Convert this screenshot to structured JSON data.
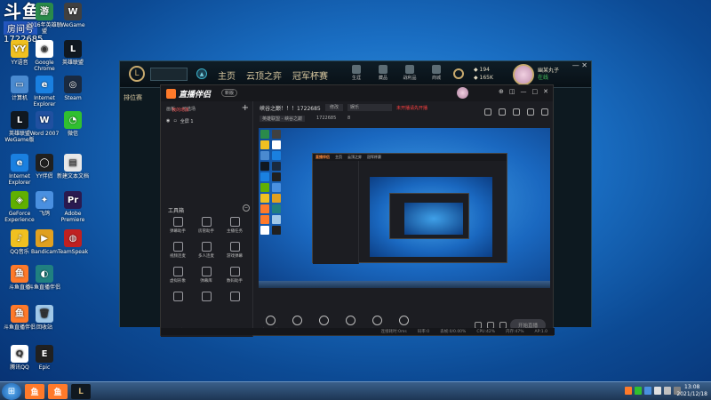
{
  "overlay": {
    "big": "斗鱼",
    "label": "房间号",
    "number": "1722685"
  },
  "desktop_icons": [
    {
      "label": "2016年英雄联盟",
      "color": "#2a8a4a",
      "glyph": "游"
    },
    {
      "label": "WeGame",
      "color": "#404040",
      "glyph": "W"
    },
    {
      "label": "YY语音",
      "color": "#f0c020",
      "glyph": "YY"
    },
    {
      "label": "Google Chrome",
      "color": "#ffffff",
      "glyph": "◉"
    },
    {
      "label": "英雄联盟",
      "color": "#101820",
      "glyph": "L"
    },
    {
      "label": "计算机",
      "color": "#4a8ad0",
      "glyph": "▭"
    },
    {
      "label": "Internet Explorer",
      "color": "#1a80e0",
      "glyph": "e"
    },
    {
      "label": "Steam",
      "color": "#1a2a40",
      "glyph": "◎"
    },
    {
      "label": "英雄联盟 WeGame版",
      "color": "#101820",
      "glyph": "L"
    },
    {
      "label": "Word 2007",
      "color": "#2050a0",
      "glyph": "W"
    },
    {
      "label": "微信",
      "color": "#30c030",
      "glyph": "◔"
    },
    {
      "label": "Internet Explorer",
      "color": "#1a80e0",
      "glyph": "e"
    },
    {
      "label": "YY伴侣",
      "color": "#202020",
      "glyph": "◯"
    },
    {
      "label": "新建文本文档",
      "color": "#e8e8e8",
      "glyph": "▤"
    },
    {
      "label": "GeForce Experience",
      "color": "#60b000",
      "glyph": "◈"
    },
    {
      "label": "飞鸽",
      "color": "#4a90e0",
      "glyph": "✦"
    },
    {
      "label": "Adobe Premiere",
      "color": "#2a1a50",
      "glyph": "Pr"
    },
    {
      "label": "QQ音乐",
      "color": "#f0c020",
      "glyph": "♪"
    },
    {
      "label": "Bandicam",
      "color": "#e0a020",
      "glyph": "▶"
    },
    {
      "label": "TeamSpeak",
      "color": "#c02020",
      "glyph": "◍"
    },
    {
      "label": "斗鱼直播",
      "color": "#ff7a2a",
      "glyph": "鱼"
    },
    {
      "label": "斗鱼直播伴侣",
      "color": "#208080",
      "glyph": "◐"
    },
    {
      "label": "斗鱼直播伴侣",
      "color": "#ff7a2a",
      "glyph": "鱼"
    },
    {
      "label": "回收站",
      "color": "#a0c8e8",
      "glyph": "🗑"
    },
    {
      "label": "腾讯QQ",
      "color": "#ffffff",
      "glyph": "Q"
    },
    {
      "label": "Epic",
      "color": "#202020",
      "glyph": "E"
    }
  ],
  "lol": {
    "nav": [
      "主页",
      "云顶之弈",
      "冠军杯赛"
    ],
    "right_icons": [
      "生涯",
      "藏品",
      "战利品",
      "商城"
    ],
    "currency_be": "194",
    "currency_rp": "165K",
    "summoner": "幽某丸子",
    "status": "在线",
    "left_title": "排位赛",
    "win_controls": "— ✕"
  },
  "stream": {
    "title": "直播伴侣",
    "version": "新版",
    "win_ctrls": [
      "⊕",
      "◫",
      "—",
      "□",
      "✕"
    ],
    "tabs": [
      "我的场景",
      "画板",
      "可选场"
    ],
    "plus": "+",
    "scene": "全屏 1",
    "toolbox_title": "工具箱",
    "toolbox_collapse": "−",
    "tools": [
      "弹幕助手",
      "房管助手",
      "主播任务",
      "视频连麦",
      "多人连麦",
      "游戏弹幕",
      "虚拟形象",
      "弹幕库",
      "数码助手",
      "",
      "",
      ""
    ],
    "hint": "斗鱼直播伴侣使用教程",
    "room_name": "峡谷之巅！！！1722685",
    "room_box1": "修改",
    "room_box2": "娱乐",
    "room_red": "未开播请先开播",
    "category": "英雄联盟 - 峡谷之巅",
    "room_id": "1722685",
    "fans": "8",
    "actions": [
      "直播弹幕",
      "摄像头",
      "手机投屏",
      "多媒体",
      "麦克风",
      "扬声器"
    ],
    "start_live": "开始直播",
    "status": [
      "连接耗时:0ms",
      "码率:0",
      "丢帧:0/0.00%",
      "CPU:42%",
      "内存:47%",
      "AP:1.0"
    ],
    "nested_bar": [
      "直播伴侣",
      "主页",
      "云顶之弈",
      "冠军杯赛"
    ]
  },
  "taskbar": {
    "start": "⊞",
    "apps": [
      {
        "color": "#ff7a2a",
        "glyph": "鱼"
      },
      {
        "color": "#ff7a2a",
        "glyph": "鱼"
      },
      {
        "color": "#101820",
        "glyph": "L"
      }
    ],
    "time": "13:08",
    "date": "2021/12/18"
  }
}
